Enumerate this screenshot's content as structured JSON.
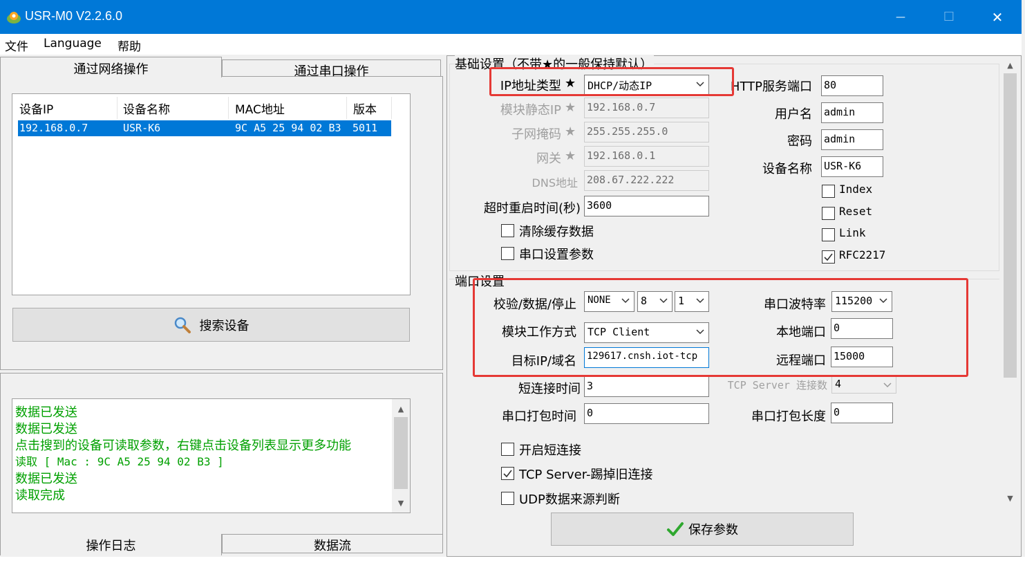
{
  "window": {
    "title": "USR-M0 V2.2.6.0",
    "minimize_glyph": "—",
    "maximize_glyph": "☐",
    "close_glyph": "✕"
  },
  "menu": [
    "文件",
    "Language",
    "帮助"
  ],
  "left": {
    "tabs": [
      "通过网络操作",
      "通过串口操作"
    ],
    "device_list": {
      "columns": [
        "设备IP",
        "设备名称",
        "MAC地址",
        "版本"
      ],
      "rows": [
        {
          "ip": "192.168.0.7",
          "name": "USR-K6",
          "mac": "9C A5 25 94 02 B3",
          "version": "5011"
        }
      ]
    },
    "search_button": "搜索设备",
    "log": [
      "数据已发送",
      "数据已发送",
      "点击搜到的设备可读取参数，右键点击设备列表显示更多功能",
      "读取 [ Mac : 9C A5 25 94 02 B3 ]",
      "数据已发送",
      "读取完成"
    ],
    "bottom_tabs": [
      "操作日志",
      "数据流"
    ]
  },
  "basic": {
    "group_title": "基础设置（不带★的一般保持默认）",
    "star": "★",
    "ip_type": {
      "label": "IP地址类型",
      "value": "DHCP/动态IP"
    },
    "static_ip": {
      "label": "模块静态IP",
      "value": "192.168.0.7"
    },
    "subnet": {
      "label": "子网掩码",
      "value": "255.255.255.0"
    },
    "gateway": {
      "label": "网关",
      "value": "192.168.0.1"
    },
    "dns": {
      "label": "DNS地址",
      "value": "208.67.222.222"
    },
    "timeout_restart": {
      "label": "超时重启时间(秒)",
      "value": "3600"
    },
    "clear_cache": {
      "label": "清除缓存数据",
      "checked": false
    },
    "serial_params": {
      "label": "串口设置参数",
      "checked": false
    },
    "http_port": {
      "label": "HTTP服务端口",
      "value": "80"
    },
    "username": {
      "label": "用户名",
      "value": "admin"
    },
    "password": {
      "label": "密码",
      "value": "admin"
    },
    "device_name": {
      "label": "设备名称",
      "value": "USR-K6"
    },
    "index": {
      "label": "Index",
      "checked": false
    },
    "reset": {
      "label": "Reset",
      "checked": false
    },
    "link": {
      "label": "Link",
      "checked": false
    },
    "rfc2217": {
      "label": "RFC2217",
      "checked": true
    }
  },
  "port": {
    "group_title": "端口设置",
    "parity_data_stop": {
      "label": "校验/数据/停止",
      "parity": "NONE",
      "data": "8",
      "stop": "1"
    },
    "work_mode": {
      "label": "模块工作方式",
      "value": "TCP Client"
    },
    "target_ip": {
      "label": "目标IP/域名",
      "value": "129617.cnsh.iot-tcp"
    },
    "short_conn_time": {
      "label": "短连接时间",
      "value": "3"
    },
    "pack_time": {
      "label": "串口打包时间",
      "value": "0"
    },
    "baud_rate": {
      "label": "串口波特率",
      "value": "115200"
    },
    "local_port": {
      "label": "本地端口",
      "value": "0"
    },
    "remote_port": {
      "label": "远程端口",
      "value": "15000"
    },
    "tcp_server_conn": {
      "label": "TCP Server 连接数",
      "value": "4"
    },
    "pack_length": {
      "label": "串口打包长度",
      "value": "0"
    },
    "enable_short_conn": {
      "label": "开启短连接",
      "checked": false
    },
    "kick_old_conn": {
      "label": "TCP Server-踢掉旧连接",
      "checked": true
    },
    "udp_source_check": {
      "label": "UDP数据来源判断",
      "checked": false
    }
  },
  "save_button": "保存参数",
  "colors": {
    "titlebar": "#0078d7",
    "selection": "#0078d7",
    "log_text": "#00a000",
    "highlight_box": "#e53935"
  }
}
